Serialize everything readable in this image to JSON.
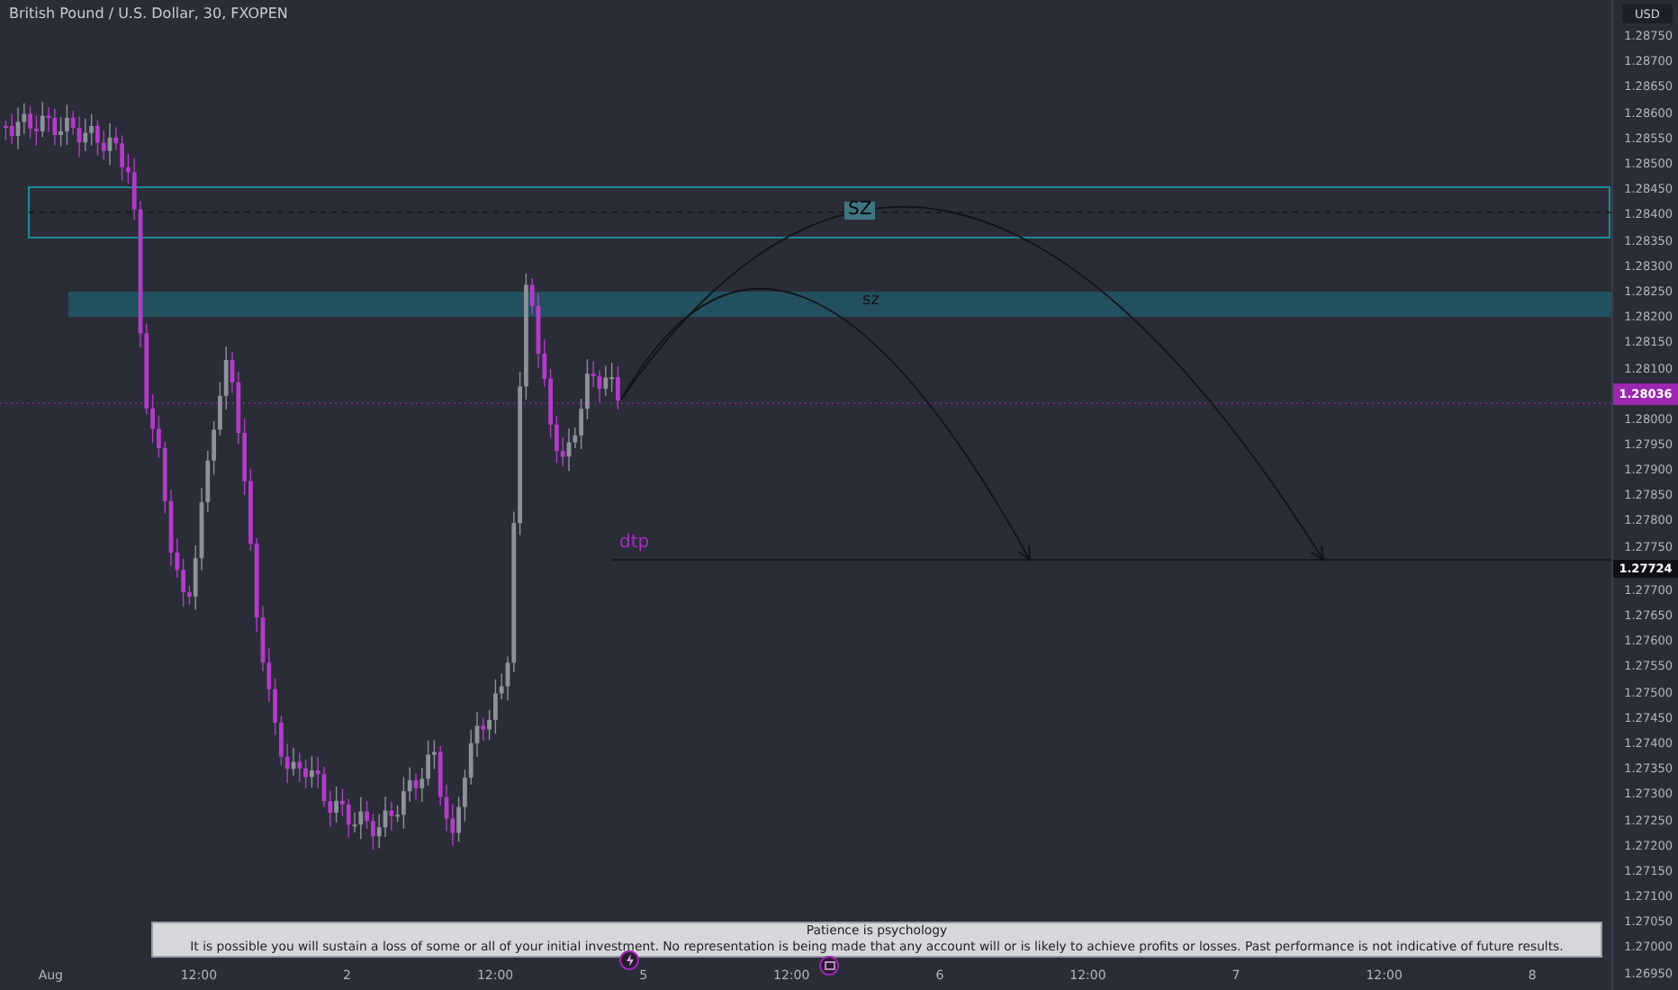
{
  "chart": {
    "title": "British Pound / U.S. Dollar, 30, FXOPEN",
    "currency": "USD",
    "price_axis_upper": [
      "1.28750",
      "1.28700",
      "1.28650",
      "1.28600",
      "1.28550",
      "1.28500",
      "1.28450",
      "1.28400",
      "1.28350",
      "1.28300",
      "1.28250",
      "1.28200",
      "1.28150",
      "1.28100"
    ],
    "current_price": "1.28036",
    "price_axis_middle": [
      "1.28000",
      "1.27950",
      "1.27900",
      "1.27850",
      "1.27800",
      "1.27750"
    ],
    "target_price": "1.27724",
    "price_axis_lower": [
      "1.27700",
      "1.27650",
      "1.27600",
      "1.27550",
      "1.27500",
      "1.27450",
      "1.27400",
      "1.27350",
      "1.27300",
      "1.27250",
      "1.27200",
      "1.27150",
      "1.27100",
      "1.27050",
      "1.27000",
      "1.26950"
    ],
    "time_axis": [
      "Aug",
      "12:00",
      "2",
      "12:00",
      "5",
      "12:00",
      "6",
      "12:00",
      "7",
      "12:00",
      "8"
    ],
    "annotations": [
      {
        "kind": "zone_outline",
        "label": "SZ"
      },
      {
        "kind": "zone_filled",
        "label": "sz"
      },
      {
        "kind": "target",
        "label": "dtp"
      }
    ],
    "note": {
      "title": "Patience is psychology",
      "text": "It is possible you will sustain a loss of some or all of your initial investment. No representation is being made that any account will or is likely to achieve profits or losses. Past performance is not indicative of future results."
    }
  }
}
